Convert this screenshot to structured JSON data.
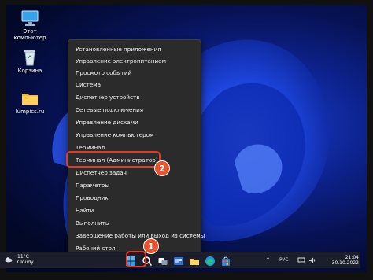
{
  "desktop": {
    "icons": [
      {
        "label": "Этот компьютер",
        "icon": "computer-icon"
      },
      {
        "label": "Корзина",
        "icon": "recycle-bin-icon"
      },
      {
        "label": "lumpics.ru",
        "icon": "folder-icon"
      }
    ]
  },
  "context_menu": {
    "items": [
      {
        "label": "Установленные приложения"
      },
      {
        "label": "Управление электропитанием"
      },
      {
        "label": "Просмотр событий"
      },
      {
        "label": "Система"
      },
      {
        "label": "Диспетчер устройств"
      },
      {
        "label": "Сетевые подключения"
      },
      {
        "label": "Управление дисками"
      },
      {
        "label": "Управление компьютером"
      },
      {
        "label": "Терминал"
      },
      {
        "label": "Терминал (Администратор)"
      },
      {
        "label": "Диспетчер задач"
      },
      {
        "label": "Параметры"
      },
      {
        "label": "Проводник"
      },
      {
        "label": "Найти"
      },
      {
        "label": "Выполнить"
      },
      {
        "label": "Завершение работы или выход из системы",
        "submenu_arrow": "›"
      },
      {
        "label": "Рабочий стол"
      }
    ]
  },
  "annotations": {
    "step1": "1",
    "step2": "2",
    "highlight_color": "#e03a2b"
  },
  "taskbar": {
    "weather": {
      "temp": "11°C",
      "condition": "Cloudy"
    },
    "language": "РУС",
    "time": "21:04",
    "date": "30.10.2022",
    "tray_chevron": "^",
    "icons": [
      "start-icon",
      "search-icon",
      "task-view-icon",
      "widgets-icon",
      "file-explorer-icon",
      "edge-icon",
      "store-icon"
    ]
  }
}
